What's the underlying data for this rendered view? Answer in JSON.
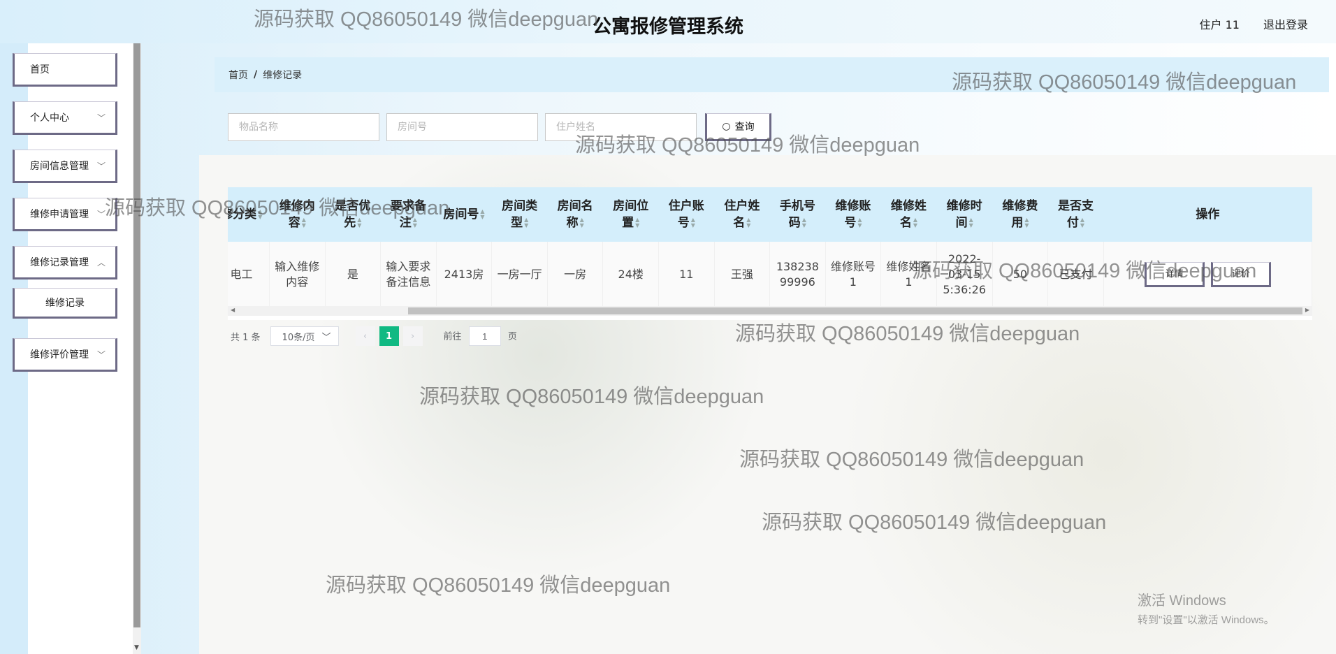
{
  "header": {
    "title": "公寓报修管理系统",
    "user_label": "住户 11",
    "logout_label": "退出登录"
  },
  "sidebar": {
    "items": [
      {
        "label": "首页",
        "chevron": false
      },
      {
        "label": "个人中心",
        "chevron": true
      },
      {
        "label": "房间信息管理",
        "chevron": true
      },
      {
        "label": "维修申请管理",
        "chevron": true
      },
      {
        "label": "维修记录管理",
        "chevron": true
      },
      {
        "label": "维修记录",
        "chevron": false,
        "sub": true
      },
      {
        "label": "维修评价管理",
        "chevron": true
      }
    ]
  },
  "breadcrumb": {
    "home": "首页",
    "separator": "/",
    "current": "维修记录"
  },
  "search": {
    "item_name_placeholder": "物品名称",
    "room_no_placeholder": "房间号",
    "resident_name_placeholder": "住户姓名",
    "query_label": "查询",
    "query_icon": "search-icon"
  },
  "table": {
    "columns": [
      "修分类",
      "维修内容",
      "是否优先",
      "要求备注",
      "房间号",
      "房间类型",
      "房间名称",
      "房间位置",
      "住户账号",
      "住户姓名",
      "手机号码",
      "维修账号",
      "维修姓名",
      "维修时间",
      "维修费用",
      "是否支付",
      "操作"
    ],
    "rows": [
      {
        "cells": [
          "电工",
          "输入维修内容",
          "是",
          "输入要求备注信息",
          "2413房",
          "一房一厅",
          "一房",
          "24楼",
          "11",
          "王强",
          "13823899996",
          "维修账号1",
          "维修姓名1",
          "2022-03-15 5:36:26",
          "50",
          "已支付"
        ],
        "actions": [
          "详情",
          "评价"
        ]
      }
    ]
  },
  "pagination": {
    "total": "共 1 条",
    "page_size": "10条/页",
    "current_page": "1",
    "goto_prefix": "前往",
    "goto_value": "1",
    "goto_suffix": "页"
  },
  "watermarks": [
    "源码获取 QQ86050149 微信deepguan"
  ],
  "os_watermark": {
    "line1": "激活 Windows",
    "line2": "转到\"设置\"以激活 Windows。"
  },
  "colors": {
    "accent": "#10b982",
    "header_bg": "#d4eefb",
    "button_border": "#6d6a86"
  }
}
